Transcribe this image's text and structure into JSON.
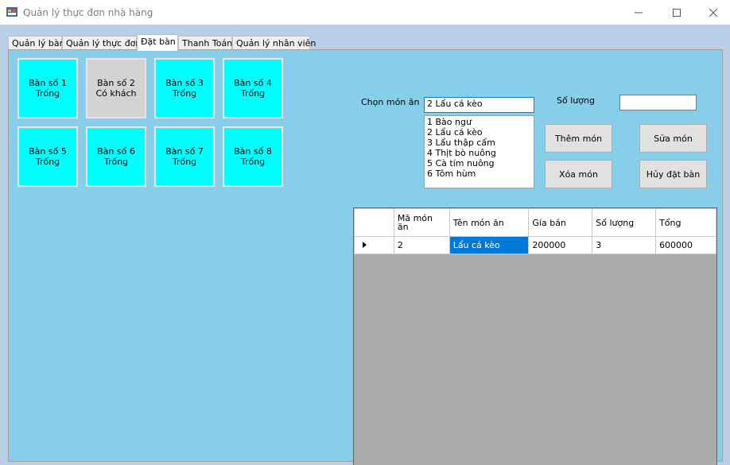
{
  "window": {
    "title": "Quản lý thực đơn nhà hàng"
  },
  "tabs": [
    {
      "label": "Quản lý bàn"
    },
    {
      "label": "Quản lý thực đơn"
    },
    {
      "label": "Đặt bàn"
    },
    {
      "label": "Thanh Toán"
    },
    {
      "label": "Quản lý nhân viên"
    }
  ],
  "tables": [
    {
      "name": "Bàn số 1",
      "status": "Trống"
    },
    {
      "name": "Bàn số 2",
      "status": "Có khách"
    },
    {
      "name": "Bàn số 3",
      "status": "Trống"
    },
    {
      "name": "Bàn số 4",
      "status": "Trống"
    },
    {
      "name": "Bàn số 5",
      "status": "Trống"
    },
    {
      "name": "Bàn số 6",
      "status": "Trống"
    },
    {
      "name": "Bàn số 7",
      "status": "Trống"
    },
    {
      "name": "Bàn số 8",
      "status": "Trống"
    }
  ],
  "colors": {
    "free": "#00ffff",
    "busy": "#d3d3d3",
    "page_bg": "#87ceeb"
  },
  "order": {
    "dish_label": "Chọn món ăn",
    "dish_selected": "2 Lẩu cá kèo",
    "dish_options": [
      "1 Bào ngư",
      "2 Lẩu cá kèo",
      "3 Lẩu thập cẩm",
      "4 Thịt bò nuông",
      "5 Cà tím nuông",
      "6 Tôm hùm"
    ],
    "qty_label": "Số lượng",
    "qty_value": ""
  },
  "buttons": {
    "add": "Thêm món",
    "edit": "Sửa món",
    "delete": "Xóa món",
    "cancel": "Hủy đặt bàn"
  },
  "grid": {
    "columns": [
      "Mã món ăn",
      "Tên món ăn",
      "Gía bán",
      "Số lượng",
      "Tổng"
    ],
    "rows": [
      {
        "id": "2",
        "name": "Lẩu cá kèo",
        "price": "200000",
        "qty": "3",
        "total": "600000"
      }
    ]
  }
}
